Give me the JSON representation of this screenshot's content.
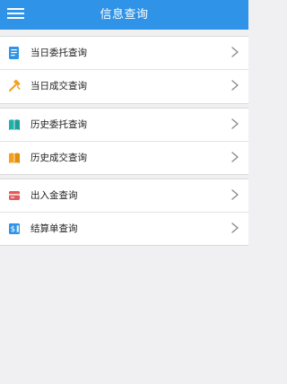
{
  "header": {
    "title": "信息查询"
  },
  "menu": {
    "items": [
      {
        "label": "当日委托查询",
        "icon": "document-icon"
      },
      {
        "label": "当日成交查询",
        "icon": "hammer-icon"
      },
      {
        "label": "历史委托查询",
        "icon": "book-icon"
      },
      {
        "label": "历史成交查询",
        "icon": "open-book-icon"
      },
      {
        "label": "出入金查询",
        "icon": "card-icon"
      },
      {
        "label": "结算单查询",
        "icon": "dollar-receipt-icon"
      }
    ]
  },
  "colors": {
    "header_bg": "#2f93e8",
    "page_bg": "#f0f0f2",
    "icon_blue": "#2f93e8",
    "icon_orange": "#f3a11e",
    "icon_teal": "#20b2aa",
    "icon_red": "#e35a5a"
  }
}
